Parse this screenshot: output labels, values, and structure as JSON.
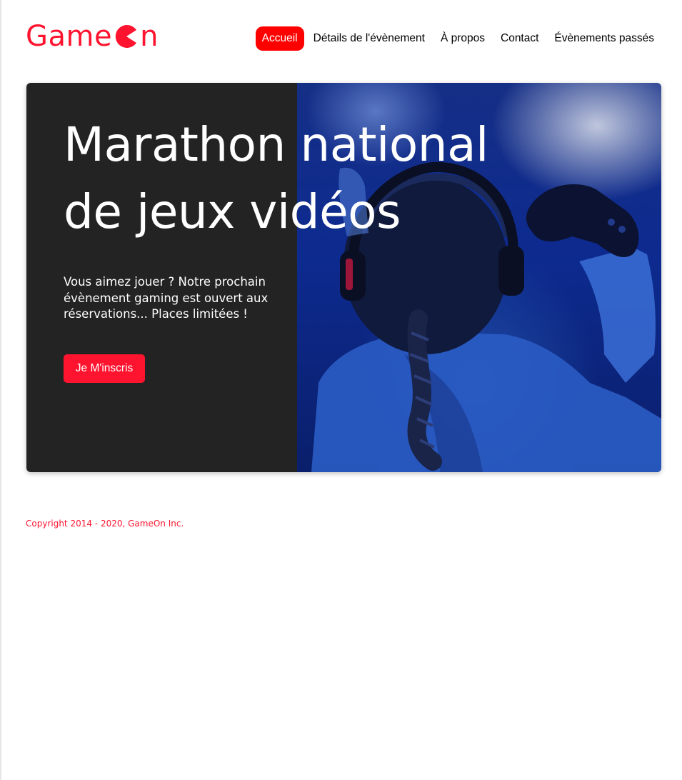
{
  "brand": {
    "logo_text_left": "Game",
    "logo_text_right": "n",
    "logo_icon": "pacman-o-icon",
    "color": "#fe142f"
  },
  "nav": {
    "items": [
      {
        "label": "Accueil",
        "active": true
      },
      {
        "label": "Détails de l'évènement",
        "active": false
      },
      {
        "label": "À propos",
        "active": false
      },
      {
        "label": "Contact",
        "active": false
      },
      {
        "label": "Évènements passés",
        "active": false
      }
    ],
    "active_color": "#ff0000"
  },
  "hero": {
    "title_line1": "Marathon national",
    "title_line2": "de jeux vidéos",
    "text": "Vous aimez jouer ? Notre prochain évènement gaming est ouvert aux réservations... Places limitées !",
    "cta_label": "Je M'inscris",
    "image": "gamer-with-headphones-and-controller-photo",
    "panel_color": "#232323"
  },
  "footer": {
    "copyright": "Copyright 2014 - 2020, GameOn Inc."
  }
}
